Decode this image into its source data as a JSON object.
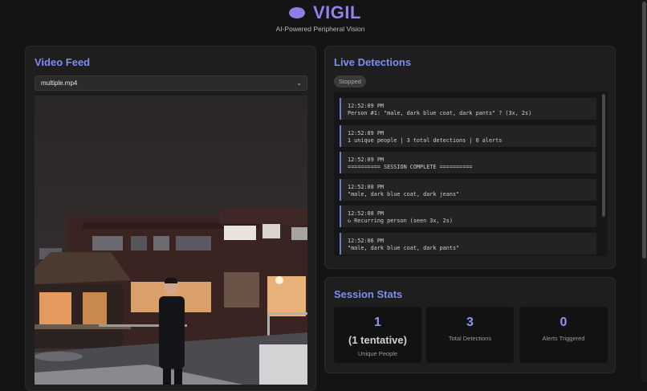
{
  "app": {
    "title": "VIGIL",
    "subtitle": "AI-Powered Peripheral Vision",
    "accent_color": "#8e84ea"
  },
  "video_feed": {
    "title": "Video Feed",
    "selected_file": "multiple.mp4"
  },
  "live_detections": {
    "title": "Live Detections",
    "status": "Stopped",
    "entries": [
      {
        "time": "12:52:09 PM",
        "message": "Person #1: \"male, dark blue coat, dark pants\" ? (3x, 2s)"
      },
      {
        "time": "12:52:09 PM",
        "message": "1 unique people | 3 total detections | 0 alerts"
      },
      {
        "time": "12:52:09 PM",
        "message": "========== SESSION COMPLETE =========="
      },
      {
        "time": "12:52:08 PM",
        "message": "\"male, dark blue coat, dark jeans\""
      },
      {
        "time": "12:52:08 PM",
        "message": "↻ Recurring person (seen 3x, 2s)"
      },
      {
        "time": "12:52:06 PM",
        "message": "\"male, dark blue coat, dark pants\""
      }
    ]
  },
  "session_stats": {
    "title": "Session Stats",
    "unique_people": {
      "value": "1",
      "sub": "(1 tentative)",
      "label": "Unique People"
    },
    "total_detections": {
      "value": "3",
      "label": "Total Detections"
    },
    "alerts_triggered": {
      "value": "0",
      "label": "Alerts Triggered"
    }
  }
}
